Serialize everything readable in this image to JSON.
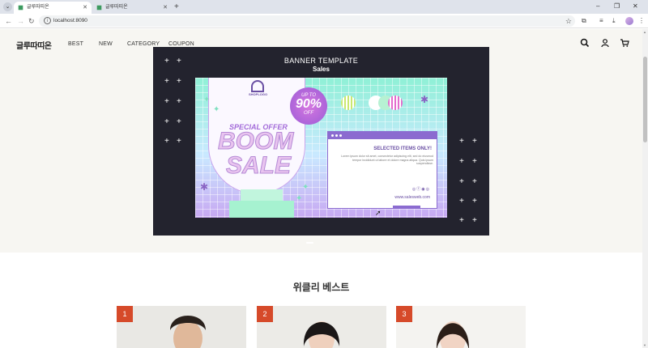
{
  "browser": {
    "tabs": [
      {
        "title": "글루따띠온",
        "active": true
      },
      {
        "title": "글루따띠온",
        "active": false
      }
    ],
    "url": "localhost:8090",
    "new_tab": "+",
    "minimize": "–",
    "restore": "❐",
    "close": "✕"
  },
  "site": {
    "logo": "글루따띠온",
    "menu": [
      "BEST",
      "NEW",
      "CATEGORY",
      "COUPON"
    ],
    "icons": [
      "search-icon",
      "user-icon",
      "cart-icon"
    ]
  },
  "banner": {
    "title": "BANNER TEMPLATE",
    "subtitle": "Sales",
    "art": {
      "shop_logo": "SHOPLOGO",
      "special_offer": "SPECIAL OFFER",
      "boom": "BOOM",
      "sale": "SALE",
      "badge_top": "UP TO",
      "badge_value": "90%",
      "badge_bottom": "OFF",
      "window_title": "SELECTED ITEMS ONLY!",
      "window_text": "Lorem ipsum dolor sit amet, consectetur adipiscing elit, sed do eiusmod tempor incididunt ut labore et dolore magna aliqua. Quis ipsum suspendisse.",
      "website": "www.salesweb.com"
    }
  },
  "weekly_best": {
    "heading": "위클리 베스트",
    "items": [
      {
        "rank": "1"
      },
      {
        "rank": "2"
      },
      {
        "rank": "3"
      }
    ]
  },
  "colors": {
    "accent_rank": "#d64a2a",
    "banner_bg": "#23232e",
    "page_bg": "#f7f6f2"
  }
}
